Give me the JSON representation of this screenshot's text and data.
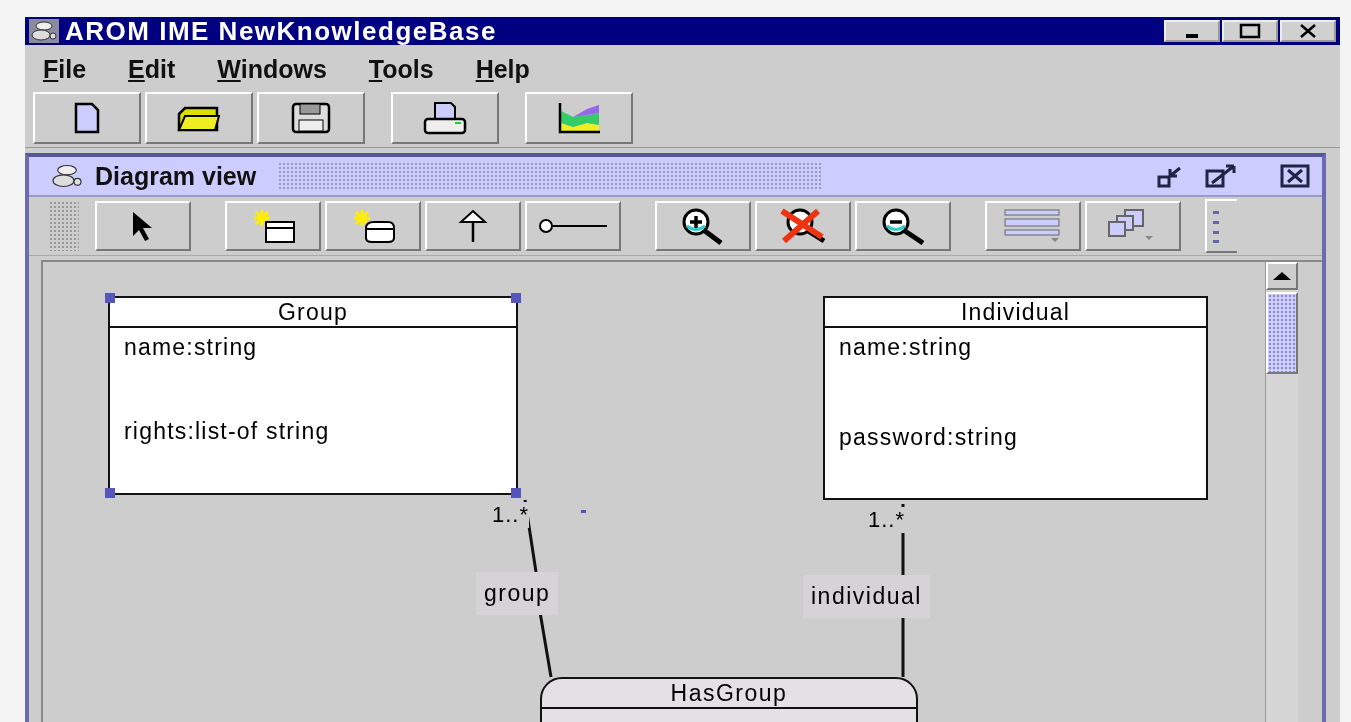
{
  "window": {
    "title": "AROM IME NewKnowledgeBase"
  },
  "menu": [
    {
      "label": "File"
    },
    {
      "label": "Edit"
    },
    {
      "label": "Windows"
    },
    {
      "label": "Tools"
    },
    {
      "label": "Help"
    }
  ],
  "toolbar": [
    [
      {
        "kind": "new"
      },
      {
        "kind": "open"
      },
      {
        "kind": "save"
      }
    ],
    [
      {
        "kind": "print"
      }
    ],
    [
      {
        "kind": "chart"
      }
    ]
  ],
  "diagram_view": {
    "title": "Diagram view",
    "tools": [
      [
        {
          "kind": "select"
        }
      ],
      [
        {
          "kind": "new-class"
        },
        {
          "kind": "new-relation"
        },
        {
          "kind": "inherit"
        },
        {
          "kind": "link"
        }
      ],
      [
        {
          "kind": "zoom-in"
        },
        {
          "kind": "zoom-reset"
        },
        {
          "kind": "zoom-out"
        }
      ],
      [
        {
          "kind": "layout"
        },
        {
          "kind": "arrange"
        }
      ]
    ],
    "classes": [
      {
        "name": "Group",
        "selected": true,
        "attributes": [
          "name:string",
          "rights:list-of string"
        ]
      },
      {
        "name": "Individual",
        "selected": false,
        "attributes": [
          "name:string",
          "password:string"
        ]
      }
    ],
    "relation": {
      "name": "HasGroup",
      "roles": [
        {
          "label": "group",
          "multiplicity": "1..*"
        },
        {
          "label": "individual",
          "multiplicity": "1..*"
        }
      ]
    }
  }
}
